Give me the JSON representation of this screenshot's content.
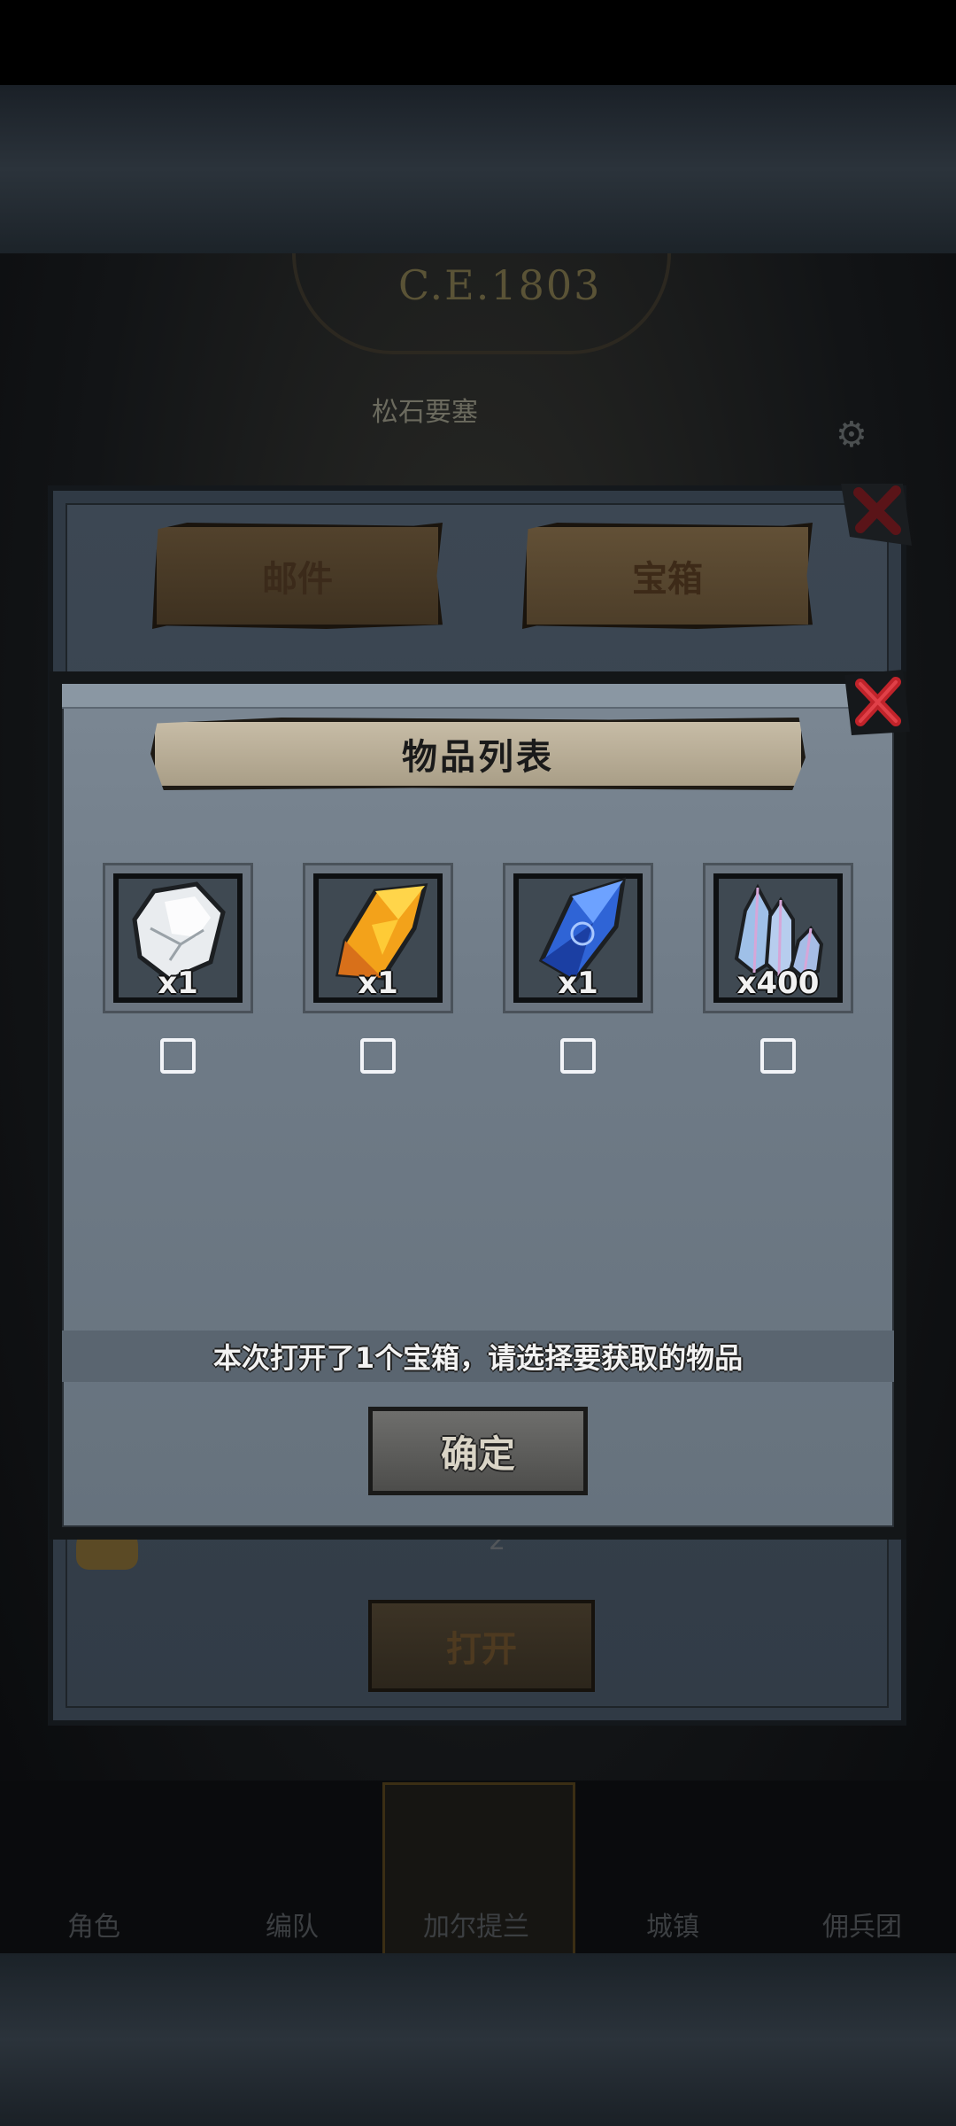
{
  "background": {
    "year": "C.E.1803",
    "location": "松石要塞",
    "back_panel": {
      "tabs": [
        {
          "label": "邮件",
          "active": false
        },
        {
          "label": "宝箱",
          "active": true
        }
      ],
      "row_count": "2",
      "open_label": "打开"
    },
    "nav": [
      {
        "label": "角色"
      },
      {
        "label": "编队"
      },
      {
        "label": "加尔提兰"
      },
      {
        "label": "城镇"
      },
      {
        "label": "佣兵团"
      }
    ]
  },
  "dialog": {
    "title": "物品列表",
    "items": [
      {
        "icon": "white-stone-icon",
        "qty": "x1",
        "checked": false
      },
      {
        "icon": "orange-crystal-icon",
        "qty": "x1",
        "checked": false
      },
      {
        "icon": "blue-crystal-icon",
        "qty": "x1",
        "checked": false
      },
      {
        "icon": "crystal-cluster-icon",
        "qty": "x400",
        "checked": false
      }
    ],
    "message": "本次打开了1个宝箱，请选择要获取的物品",
    "confirm_label": "确定"
  },
  "colors": {
    "close_red": "#c0232a",
    "panel_face": "#77838f",
    "title_plate": "#bdb29b"
  }
}
